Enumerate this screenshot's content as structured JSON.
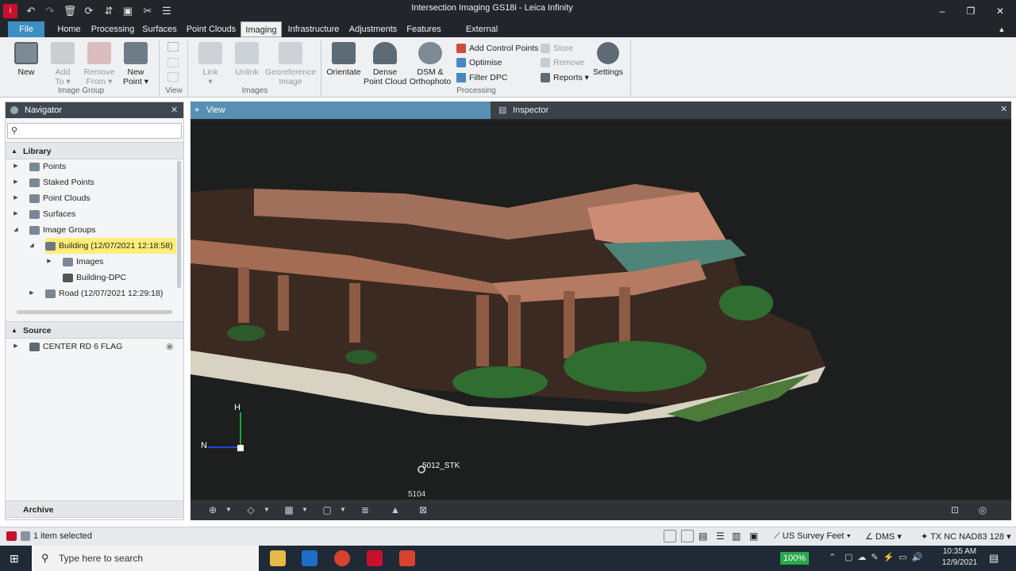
{
  "window": {
    "title": "Intersection Imaging GS18i - Leica Infinity"
  },
  "menu": {
    "file": "File",
    "home": "Home",
    "processing": "Processing",
    "surfaces": "Surfaces",
    "point_clouds": "Point Clouds",
    "imaging": "Imaging",
    "infrastructure": "Infrastructure",
    "adjustments": "Adjustments",
    "features": "Features",
    "external_services": "External Services"
  },
  "ribbon": {
    "new": "New",
    "add_to": "Add\nTo ▾",
    "remove_from": "Remove\nFrom ▾",
    "new_point": "New\nPoint ▾",
    "group_image": "Image Group",
    "group_view": "View",
    "link": "Link\n▾",
    "unlink": "Unlink",
    "georeference": "Georeference\nImage",
    "group_images": "Images",
    "orientate": "Orientate",
    "dense": "Dense\nPoint Cloud",
    "dsm": "DSM &\nOrthophoto",
    "add_cp": "Add Control Points",
    "optimise": "Optimise",
    "filter_dpc": "Filter DPC",
    "store": "Store",
    "remove": "Remove",
    "reports": "Reports ▾",
    "settings": "Settings",
    "group_processing": "Processing"
  },
  "navigator": {
    "title": "Navigator",
    "search_placeholder": "",
    "library": "Library",
    "items": {
      "points": "Points",
      "staked": "Staked Points",
      "clouds": "Point Clouds",
      "surfaces": "Surfaces",
      "groups": "Image Groups",
      "building": "Building (12/07/2021 12:18:58)",
      "images": "Images",
      "dpc": "Building-DPC",
      "road": "Road (12/07/2021 12:29:18)"
    },
    "source": "Source",
    "source_item": "CENTER RD 6 FLAG",
    "archive": "Archive"
  },
  "view": {
    "tab_view": "View",
    "tab_inspector": "Inspector",
    "axis_h": "H",
    "axis_n": "N",
    "label_stk": "5012_STK",
    "label_5104": "5104"
  },
  "status": {
    "selected": "1 item selected",
    "units": "US Survey Feet",
    "angle": "DMS",
    "coord": "TX NC NAD83 128"
  },
  "taskbar": {
    "search": "Type here to search",
    "zoom": "100%",
    "time": "10:35 AM",
    "date": "12/9/2021"
  },
  "colors": {
    "accent": "#3c8fc2",
    "highlight": "#ffef7a"
  }
}
